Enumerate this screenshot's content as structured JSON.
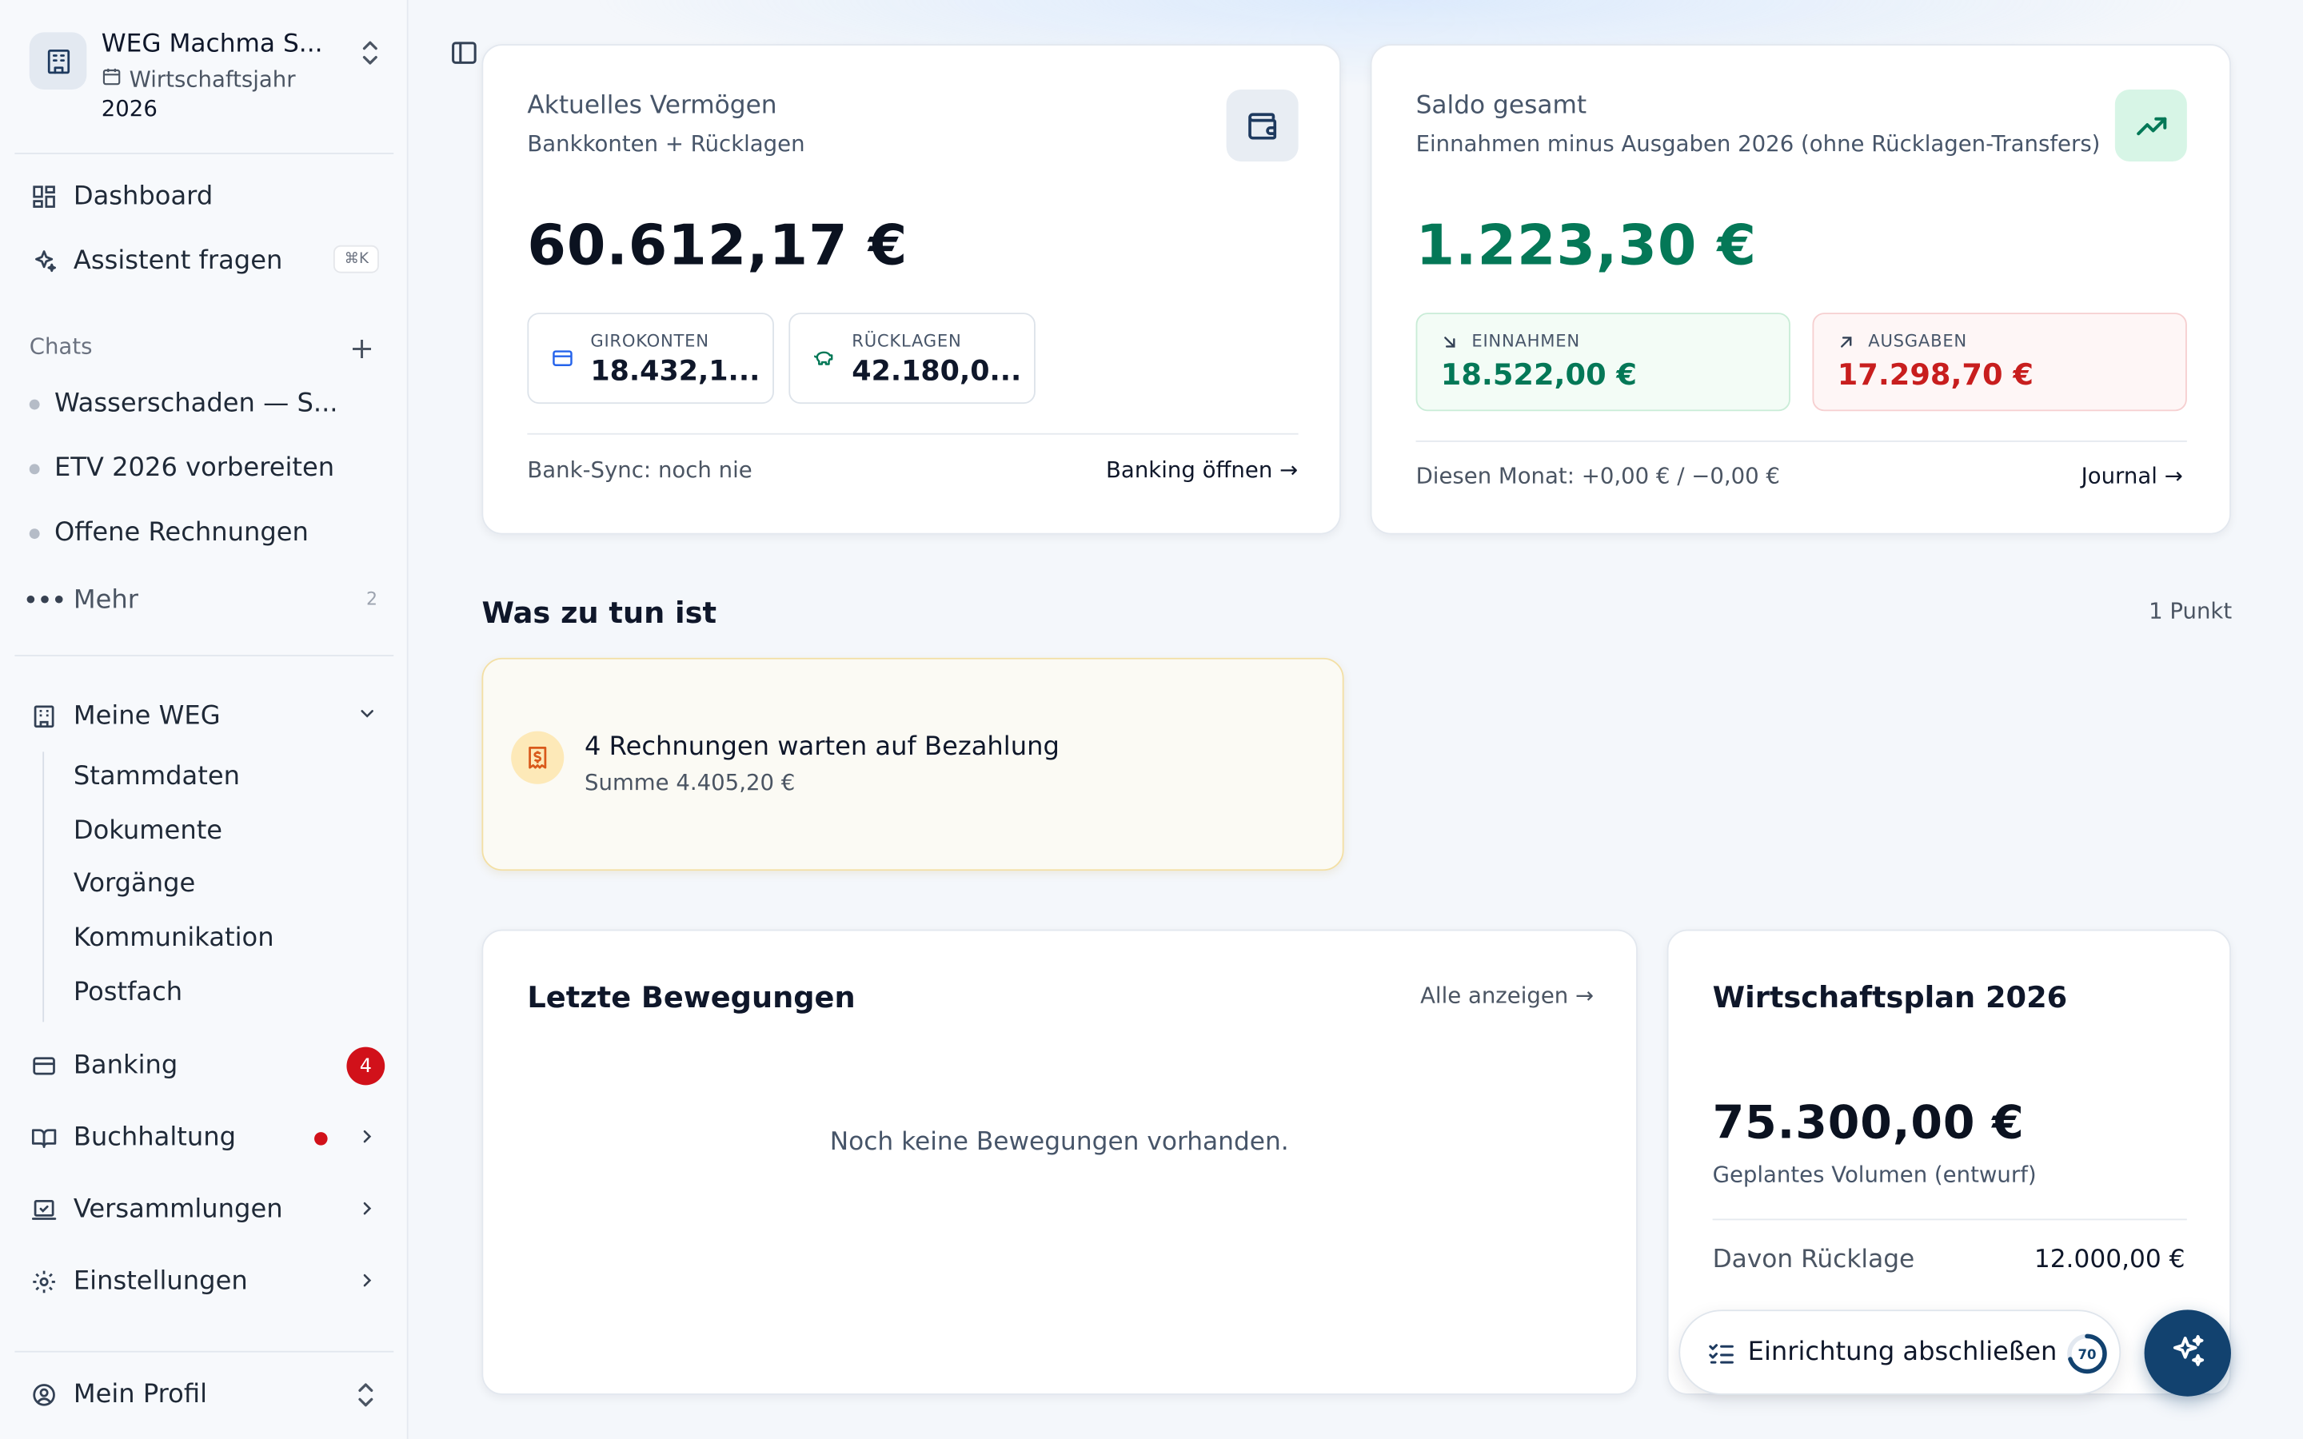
{
  "workspace": {
    "name": "WEG Machma S...",
    "year_label": "Wirtschaftsjahr",
    "year": "2026"
  },
  "nav": {
    "dashboard": "Dashboard",
    "assistant": "Assistent fragen",
    "assistant_shortcut": "⌘K",
    "chats_label": "Chats",
    "chats": [
      "Wasserschaden — S...",
      "ETV 2026 vorbereiten",
      "Offene Rechnungen"
    ],
    "more": "Mehr",
    "more_count": "2",
    "meine_weg": "Meine WEG",
    "sub_items": [
      "Stammdaten",
      "Dokumente",
      "Vorgänge",
      "Kommunikation",
      "Postfach"
    ],
    "banking": "Banking",
    "banking_badge": "4",
    "buchhaltung": "Buchhaltung",
    "versammlungen": "Versammlungen",
    "einstellungen": "Einstellungen",
    "profile": "Mein Profil"
  },
  "vermoegen": {
    "title": "Aktuelles Vermögen",
    "subtitle": "Bankkonten + Rücklagen",
    "amount": "60.612,17 €",
    "giro_label": "GIROKONTEN",
    "giro_value": "18.432,1...",
    "ruecklagen_label": "RÜCKLAGEN",
    "ruecklagen_value": "42.180,0...",
    "sync": "Bank-Sync: noch nie",
    "link": "Banking öffnen"
  },
  "saldo": {
    "title": "Saldo gesamt",
    "subtitle": "Einnahmen minus Ausgaben 2026 (ohne Rücklagen-Transfers)",
    "amount": "1.223,30 €",
    "einnahmen_label": "EINNAHMEN",
    "einnahmen_value": "18.522,00 €",
    "ausgaben_label": "AUSGABEN",
    "ausgaben_value": "17.298,70 €",
    "month": "Diesen Monat: +0,00 € / −0,00 €",
    "link": "Journal"
  },
  "todo": {
    "title": "Was zu tun ist",
    "count": "1 Punkt",
    "task_title": "4 Rechnungen warten auf Bezahlung",
    "task_sub": "Summe 4.405,20 €"
  },
  "bewegungen": {
    "title": "Letzte Bewegungen",
    "link": "Alle anzeigen",
    "empty": "Noch keine Bewegungen vorhanden."
  },
  "plan": {
    "title": "Wirtschaftsplan 2026",
    "amount": "75.300,00 €",
    "subtitle": "Geplantes Volumen (entwurf)",
    "row_label": "Davon Rücklage",
    "row_value": "12.000,00 €"
  },
  "setup": {
    "label": "Einrichtung abschließen",
    "progress": "70",
    "progress_fraction": 0.7
  },
  "colors": {
    "green": "#047857",
    "red": "#c81e1e",
    "navy": "#12426f"
  }
}
